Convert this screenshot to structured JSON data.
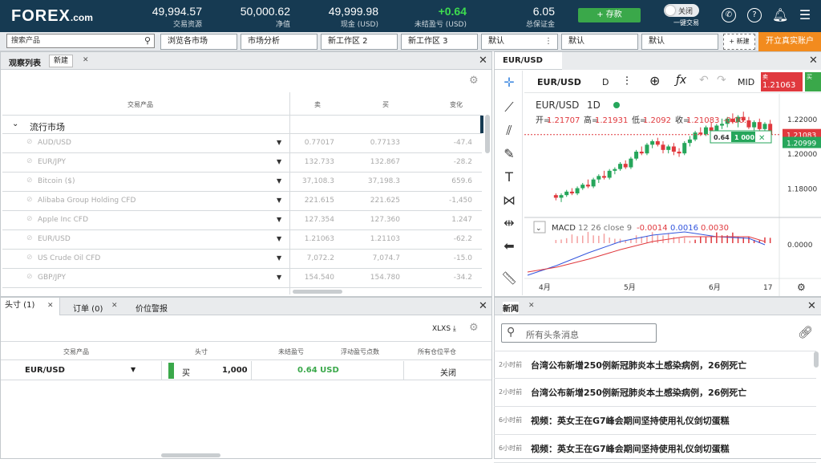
{
  "brand": {
    "name": "FOREX",
    "suffix": ".com"
  },
  "header": {
    "stats": [
      {
        "value": "49,994.57",
        "label": "交易资源"
      },
      {
        "value": "50,000.62",
        "label": "净值"
      },
      {
        "value": "49,999.98",
        "label": "现金 (USD)"
      },
      {
        "value": "+0.64",
        "label": "未结盈亏 (USD)"
      },
      {
        "value": "6.05",
        "label": "总保证金"
      }
    ],
    "deposit_label": "+ 存款",
    "one_click": {
      "state": "关闭",
      "label": "一键交易"
    },
    "icons": [
      "phone-icon",
      "help-icon",
      "bell-icon",
      "menu-icon"
    ]
  },
  "toolbar": {
    "search_placeholder": "搜索产品",
    "tabs": [
      "浏览各市场",
      "市场分析",
      "新工作区 2",
      "新工作区 3",
      "默认",
      "默认",
      "默认"
    ],
    "new_tab": "+ 新建",
    "real_account": "开立真实账户"
  },
  "watchlist": {
    "title": "观察列表",
    "new_label": "新建",
    "columns": [
      "交易产品",
      "卖",
      "买",
      "变化"
    ],
    "group": "流行市场",
    "rows": [
      {
        "name": "AUD/USD",
        "sell": "0.77017",
        "buy": "0.77133",
        "change": "-47.4"
      },
      {
        "name": "EUR/JPY",
        "sell": "132.733",
        "buy": "132.867",
        "change": "-28.2"
      },
      {
        "name": "Bitcoin ($)",
        "sell": "37,108.3",
        "buy": "37,198.3",
        "change": "659.6"
      },
      {
        "name": "Alibaba Group Holding CFD",
        "sell": "221.615",
        "buy": "221.625",
        "change": "-1,450"
      },
      {
        "name": "Apple Inc CFD",
        "sell": "127.354",
        "buy": "127.360",
        "change": "1.247"
      },
      {
        "name": "EUR/USD",
        "sell": "1.21063",
        "buy": "1.21103",
        "change": "-62.2"
      },
      {
        "name": "US Crude Oil CFD",
        "sell": "7,072.2",
        "buy": "7,074.7",
        "change": "-15.0"
      },
      {
        "name": "GBP/JPY",
        "sell": "154.540",
        "buy": "154.780",
        "change": "-34.2"
      }
    ]
  },
  "chart_panel": {
    "tab": "EUR/USD",
    "symbol": "EUR/USD",
    "interval": "D",
    "price_type": "MID",
    "sell_label": "卖",
    "sell_price": "1.21063",
    "buy_label": "买",
    "legend": {
      "title": "EUR/USD",
      "interval": "1D",
      "open_label": "开=",
      "open": "1.21707",
      "high_label": "高=",
      "high": "1.21931",
      "low_label": "低=",
      "low": "1.2092",
      "close_label": "收=",
      "close": "1.21083",
      "tail": "-0.00..."
    },
    "trade_widget": {
      "pnl": "0.64",
      "qty": "1 000"
    },
    "macd": {
      "label": "MACD",
      "params": "12 26 close 9",
      "v1": "-0.0014",
      "v2": "0.0016",
      "v3": "0.0030"
    }
  },
  "chart_data": {
    "type": "candlestick",
    "ylim": [
      1.165,
      1.225
    ],
    "y_ticks": [
      "1.22000",
      "1.20000",
      "1.18000"
    ],
    "price_labels": [
      "1.21083",
      "1.20999"
    ],
    "x_ticks": [
      "4月",
      "5月",
      "6月",
      "17"
    ],
    "macd_tick": "0.0000",
    "candles": [
      [
        1.176,
        1.177,
        1.173,
        1.1745
      ],
      [
        1.1745,
        1.177,
        1.172,
        1.176
      ],
      [
        1.176,
        1.179,
        1.175,
        1.178
      ],
      [
        1.178,
        1.18,
        1.176,
        1.177
      ],
      [
        1.177,
        1.181,
        1.176,
        1.18
      ],
      [
        1.18,
        1.183,
        1.179,
        1.182
      ],
      [
        1.182,
        1.185,
        1.18,
        1.181
      ],
      [
        1.181,
        1.186,
        1.18,
        1.185
      ],
      [
        1.185,
        1.188,
        1.183,
        1.187
      ],
      [
        1.187,
        1.19,
        1.185,
        1.186
      ],
      [
        1.186,
        1.191,
        1.185,
        1.19
      ],
      [
        1.19,
        1.192,
        1.188,
        1.191
      ],
      [
        1.191,
        1.195,
        1.19,
        1.194
      ],
      [
        1.194,
        1.196,
        1.191,
        1.192
      ],
      [
        1.192,
        1.198,
        1.191,
        1.197
      ],
      [
        1.197,
        1.202,
        1.196,
        1.201
      ],
      [
        1.201,
        1.204,
        1.199,
        1.2
      ],
      [
        1.2,
        1.206,
        1.199,
        1.205
      ],
      [
        1.205,
        1.208,
        1.203,
        1.207
      ],
      [
        1.207,
        1.209,
        1.204,
        1.205
      ],
      [
        1.205,
        1.207,
        1.2,
        1.202
      ],
      [
        1.202,
        1.205,
        1.2,
        1.204
      ],
      [
        1.204,
        1.206,
        1.199,
        1.201
      ],
      [
        1.201,
        1.203,
        1.198,
        1.2
      ],
      [
        1.2,
        1.207,
        1.199,
        1.206
      ],
      [
        1.206,
        1.21,
        1.204,
        1.208
      ],
      [
        1.208,
        1.213,
        1.207,
        1.212
      ],
      [
        1.212,
        1.215,
        1.21,
        1.211
      ],
      [
        1.211,
        1.216,
        1.21,
        1.215
      ],
      [
        1.215,
        1.218,
        1.212,
        1.213
      ],
      [
        1.213,
        1.217,
        1.21,
        1.216
      ],
      [
        1.216,
        1.22,
        1.214,
        1.217
      ],
      [
        1.217,
        1.221,
        1.215,
        1.22
      ],
      [
        1.22,
        1.223,
        1.217,
        1.218
      ],
      [
        1.218,
        1.222,
        1.215,
        1.221
      ],
      [
        1.221,
        1.224,
        1.218,
        1.219
      ],
      [
        1.219,
        1.221,
        1.214,
        1.215
      ],
      [
        1.215,
        1.219,
        1.212,
        1.218
      ],
      [
        1.218,
        1.22,
        1.213,
        1.214
      ],
      [
        1.214,
        1.218,
        1.211,
        1.217
      ],
      [
        1.217,
        1.2193,
        1.2092,
        1.2108
      ]
    ]
  },
  "positions": {
    "tabs": [
      "头寸 (1)",
      "订单 (0)",
      "价位警报"
    ],
    "export": "XLXS",
    "columns": [
      "交易产品",
      "头寸",
      "未结盈亏",
      "浮动盈亏点数",
      "所有仓位平仓"
    ],
    "rows": [
      {
        "symbol": "EUR/USD",
        "side": "买",
        "qty": "1,000",
        "pnl": "0.64 USD",
        "action": "关闭"
      }
    ]
  },
  "news": {
    "title": "新闻",
    "search_placeholder": "所有头条消息",
    "items": [
      {
        "time": "2小时前",
        "headline": "台湾公布新增250例新冠肺炎本土感染病例，26例死亡"
      },
      {
        "time": "2小时前",
        "headline": "台湾公布新增250例新冠肺炎本土感染病例，26例死亡"
      },
      {
        "time": "6小时前",
        "headline": "视频：英女王在G7峰会期间坚持使用礼仪剑切蛋糕"
      },
      {
        "time": "6小时前",
        "headline": "视频：英女王在G7峰会期间坚持使用礼仪剑切蛋糕"
      }
    ]
  },
  "colors": {
    "nav": "#163a52",
    "green": "#3aa84a",
    "red": "#e0393e",
    "orange": "#f28b1e"
  }
}
